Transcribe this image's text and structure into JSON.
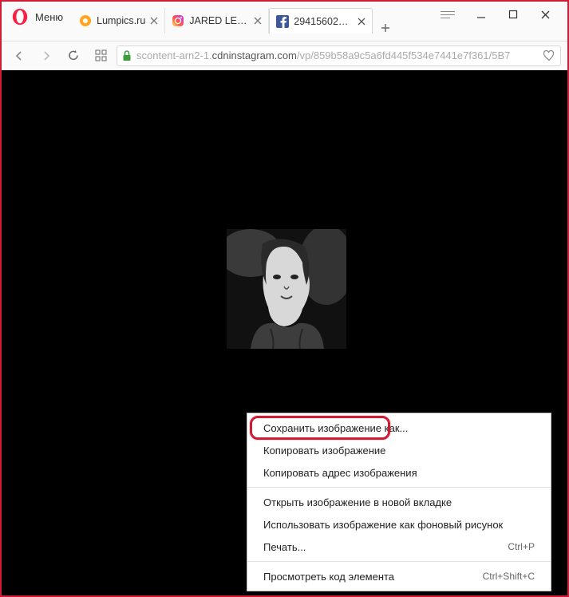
{
  "titlebar": {
    "menu_label": "Меню",
    "tabs": [
      {
        "label": "Lumpics.ru"
      },
      {
        "label": "JARED LETO ("
      },
      {
        "label": "29415602_67"
      }
    ]
  },
  "addressbar": {
    "url_prefix": "scontent-arn2-1.",
    "url_main": "cdninstagram.com",
    "url_suffix": "/vp/859b58a9c5a6fd445f534e7441e7f361/5B7"
  },
  "context_menu": {
    "items": [
      {
        "label": "Сохранить изображение как...",
        "shortcut": ""
      },
      {
        "label": "Копировать изображение",
        "shortcut": ""
      },
      {
        "label": "Копировать адрес изображения",
        "shortcut": ""
      },
      {
        "sep": true
      },
      {
        "label": "Открыть изображение в новой вкладке",
        "shortcut": ""
      },
      {
        "label": "Использовать изображение как фоновый рисунок",
        "shortcut": ""
      },
      {
        "label": "Печать...",
        "shortcut": "Ctrl+P"
      },
      {
        "sep": true
      },
      {
        "label": "Просмотреть код элемента",
        "shortcut": "Ctrl+Shift+C"
      }
    ]
  }
}
